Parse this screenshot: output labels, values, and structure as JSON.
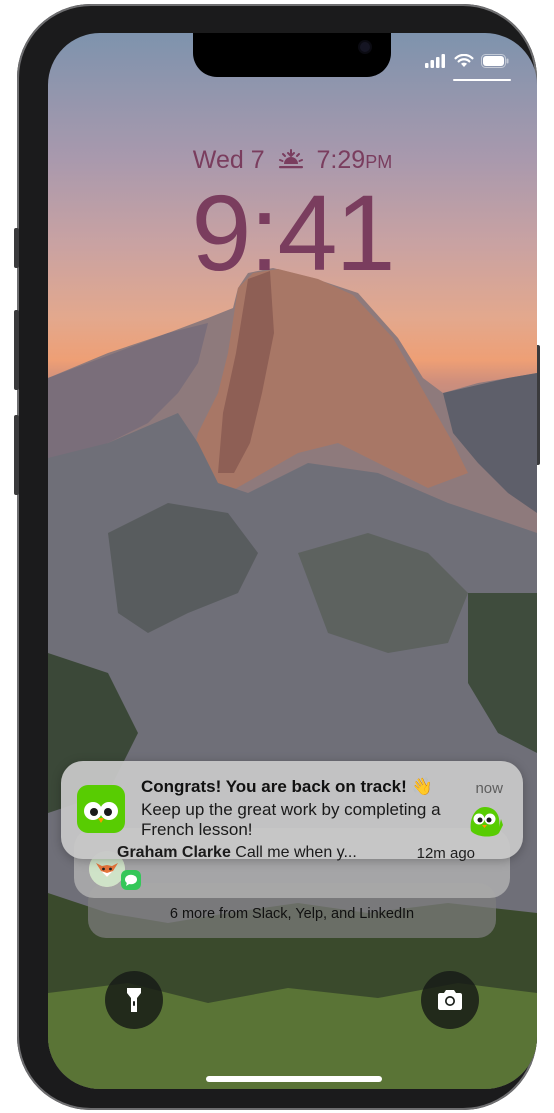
{
  "status_bar": {
    "signal_icon": "signal-icon",
    "wifi_icon": "wifi-icon",
    "battery_icon": "battery-icon"
  },
  "lock_screen": {
    "date": "Wed 7",
    "sunset_icon": "sunset-icon",
    "sunset_time": "7:29",
    "sunset_ampm": "PM",
    "time": "9:41"
  },
  "notifications": {
    "primary": {
      "app_icon": "duolingo-icon",
      "title": "Congrats! You are back on track! 👋",
      "body": "Keep up the great work by completing a French lesson!",
      "time": "now"
    },
    "secondary": {
      "sender": "Graham Clarke",
      "message": "Call me when y...",
      "time": "12m ago",
      "badge_icon": "messages-icon"
    },
    "summary": {
      "text": "6 more from Slack, Yelp, and LinkedIn"
    }
  },
  "quick_actions": {
    "flashlight_icon": "flashlight-icon",
    "camera_icon": "camera-icon"
  },
  "colors": {
    "clock": "#7a3d5e",
    "duolingo_green": "#58cc02",
    "messages_green": "#34c759"
  }
}
